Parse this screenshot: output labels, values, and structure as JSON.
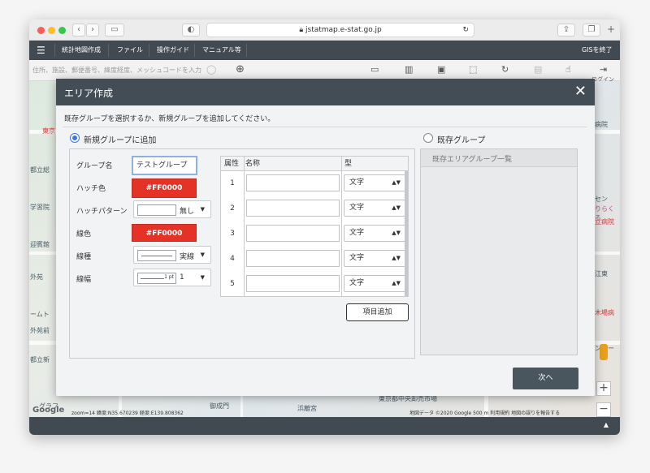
{
  "browser": {
    "url": "jstatmap.e-stat.go.jp",
    "colors": {
      "close": "#fc5c57",
      "minimize": "#fdbc2e",
      "zoom": "#34c84a"
    }
  },
  "menu": {
    "items": [
      "統計地図作成",
      "ファイル",
      "操作ガイド",
      "マニュアル等"
    ],
    "exit_label": "GISを終了"
  },
  "toolbar": {
    "search_placeholder": "住所、施設、郵便番号、緯度経度、メッシュコードを入力",
    "login_label": "ログイン"
  },
  "map": {
    "labels": [
      "東京",
      "都立総",
      "学習院",
      "迎賓館",
      "外苑",
      "ームト",
      "外苑前",
      "都立新",
      "グラフ",
      "御成門",
      "浜離宮",
      "東京都中央卸売市場",
      "病院",
      "セン",
      "りらくろ",
      "立病院",
      "木場病",
      "ンター",
      "江東"
    ],
    "scale_text": "zoom=14 緯度:N35.670239 経度:E139.808362",
    "attribution": "地図データ ©2020 Google  500 m  利用規約  地図の誤りを報告する",
    "google_label": "Google"
  },
  "dialog": {
    "title": "エリア作成",
    "instruction": "既存グループを選択するか、新規グループを追加してください。",
    "new_group_label": "新規グループに追加",
    "existing_group_label": "既存グループ",
    "existing_list_header": "既存エリアグループ一覧",
    "fields": {
      "group_name_label": "グループ名",
      "group_name_value": "テストグループ",
      "hatch_color_label": "ハッチ色",
      "hatch_color_value": "#FF0000",
      "hatch_pattern_label": "ハッチパターン",
      "hatch_pattern_value": "無し",
      "line_color_label": "線色",
      "line_color_value": "#FF0000",
      "line_type_label": "線種",
      "line_type_value": "実線",
      "line_width_label": "線幅",
      "line_width_value": "1",
      "line_width_unit": "1 pt"
    },
    "attr_table": {
      "headers": [
        "属性",
        "名称",
        "型"
      ],
      "rows": [
        {
          "num": "1",
          "type": "文字"
        },
        {
          "num": "2",
          "type": "文字"
        },
        {
          "num": "3",
          "type": "文字"
        },
        {
          "num": "4",
          "type": "文字"
        },
        {
          "num": "5",
          "type": "文字"
        }
      ]
    },
    "add_item_label": "項目追加",
    "next_label": "次へ",
    "accent_color": "#e53227",
    "radio_color": "#3b78e7"
  }
}
